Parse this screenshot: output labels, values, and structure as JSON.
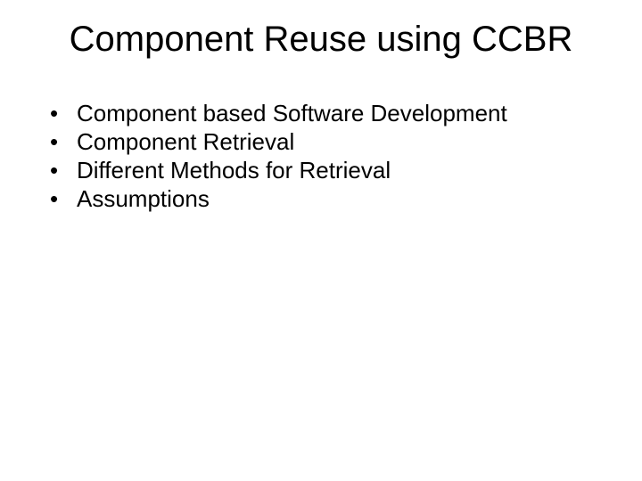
{
  "slide": {
    "title": "Component Reuse using CCBR",
    "bullets": [
      "Component based Software Development",
      "Component Retrieval",
      "Different Methods for Retrieval",
      "Assumptions"
    ]
  }
}
